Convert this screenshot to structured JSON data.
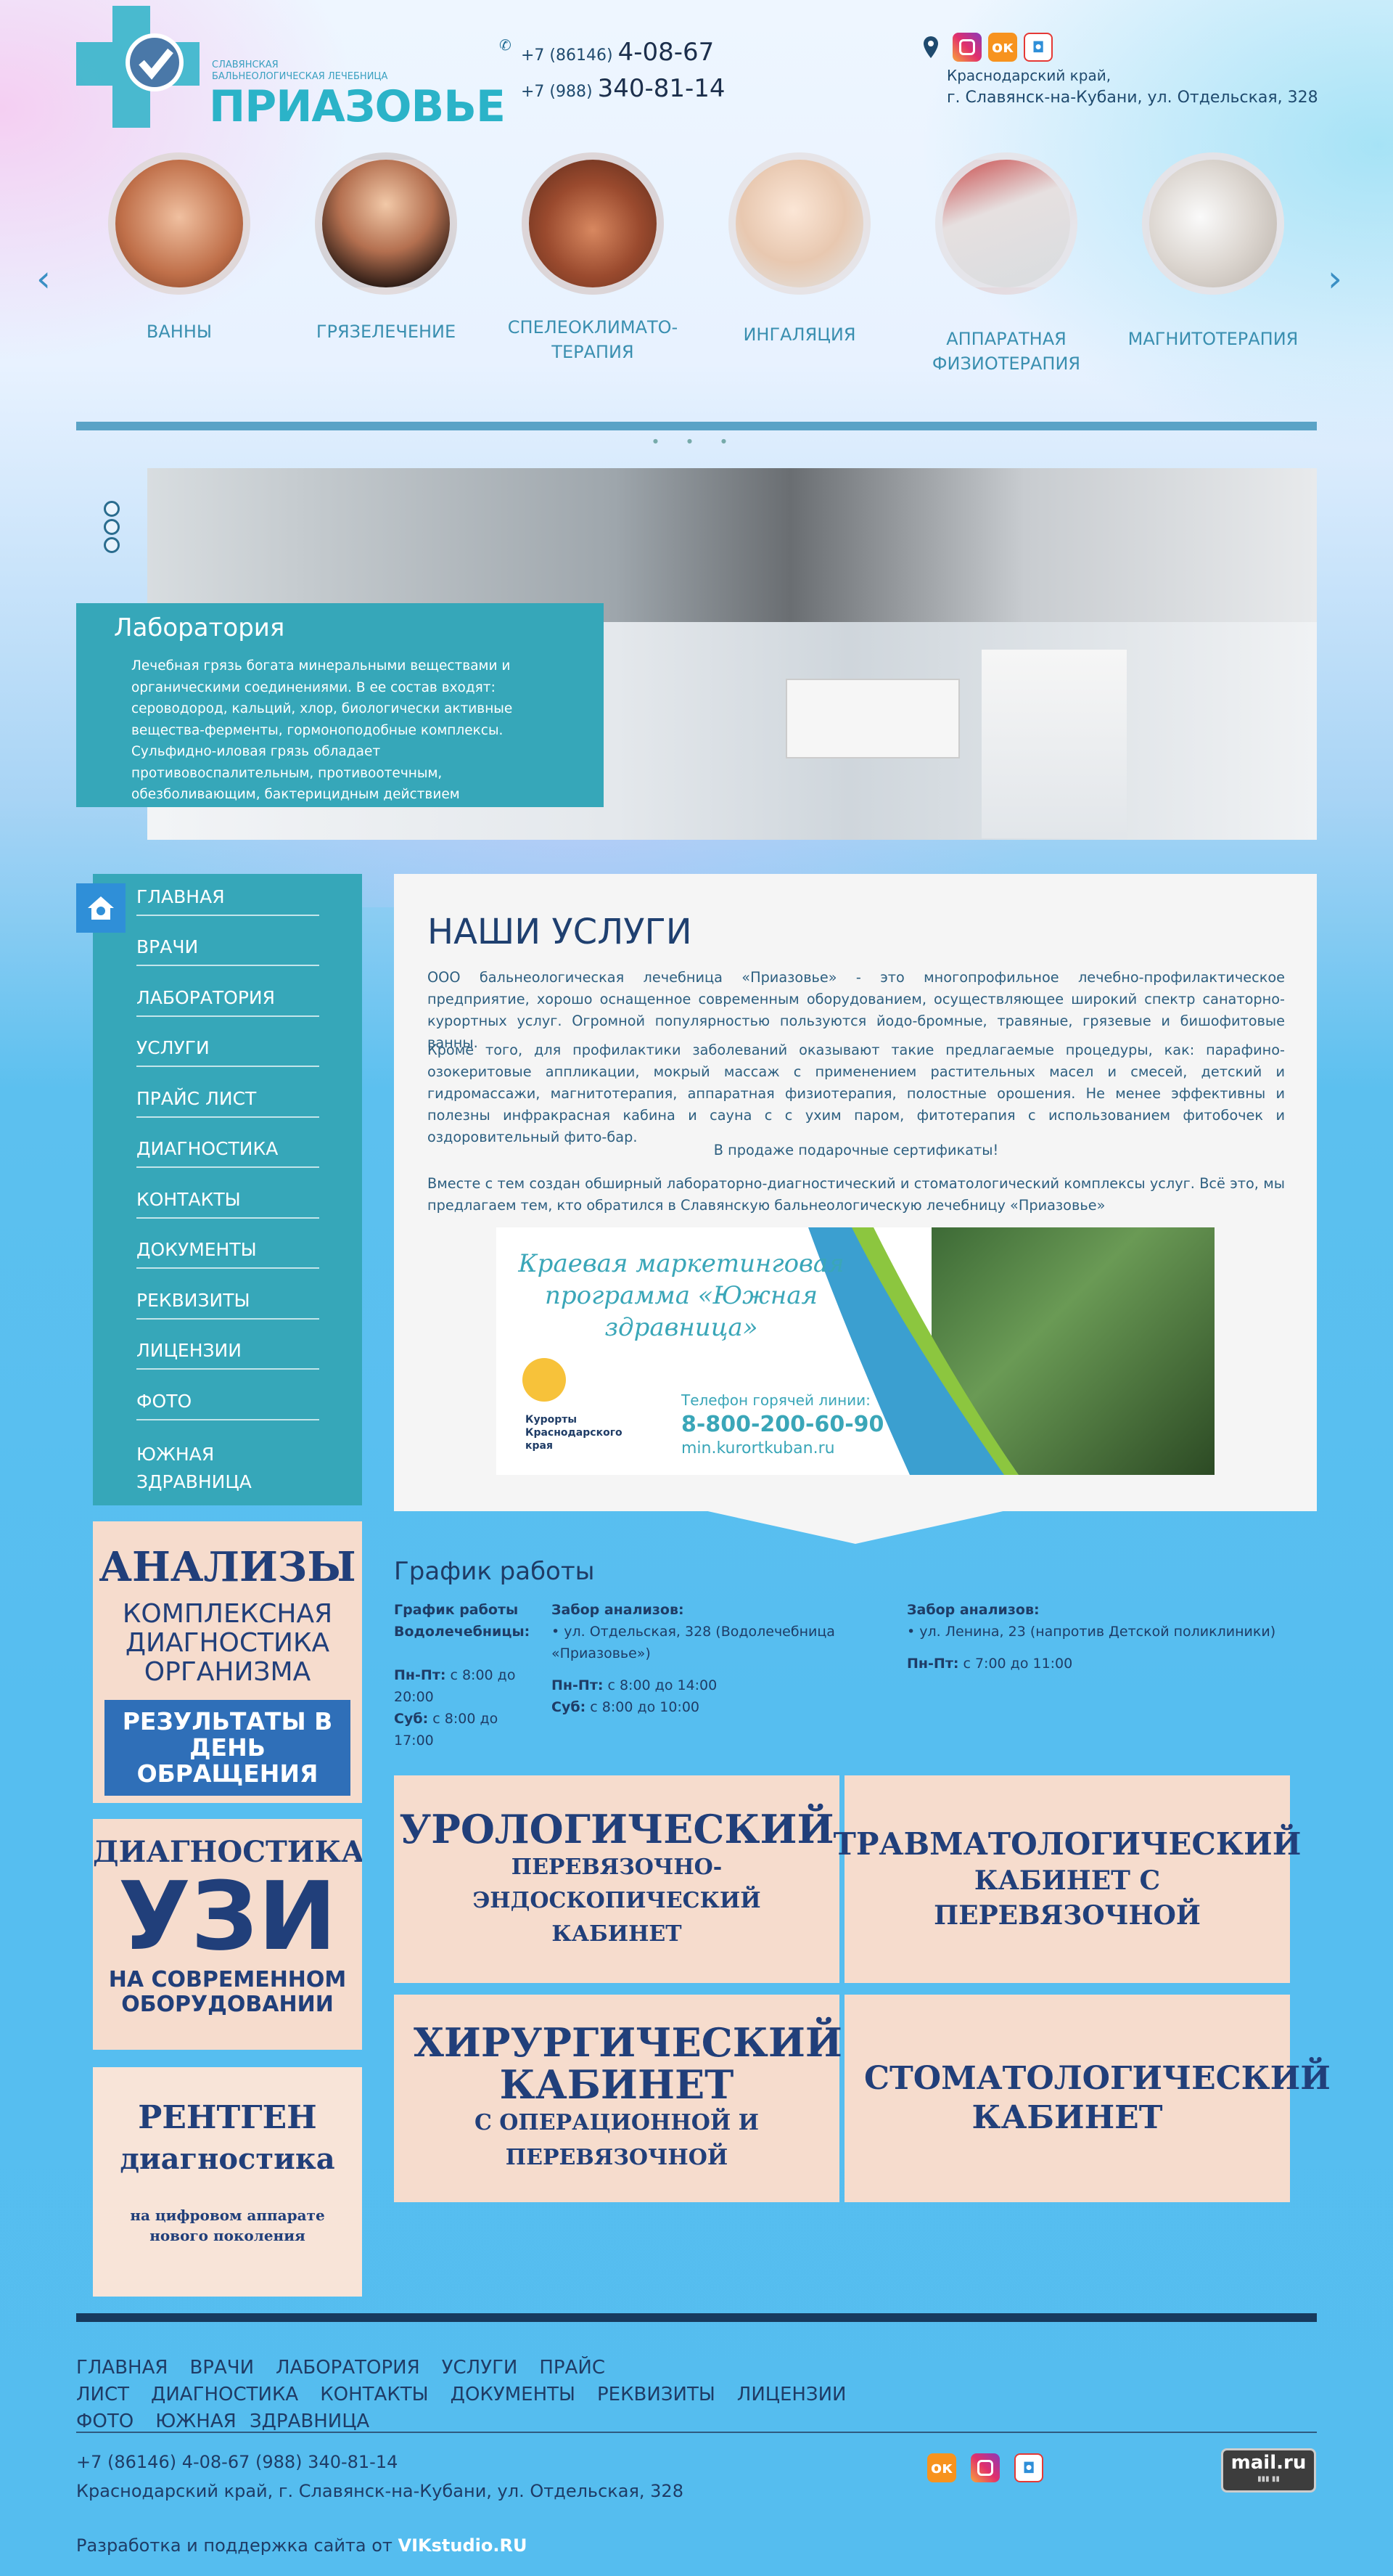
{
  "colors": {
    "accent": "#36a7b9",
    "dark": "#1f3c66",
    "peach": "#f6dccd"
  },
  "header": {
    "logo_sub": "СЛАВЯНСКАЯ\nБАЛЬНЕОЛОГИЧЕСКАЯ ЛЕЧЕБНИЦА",
    "logo_name": "ПРИАЗОВЬЕ",
    "phone1_prefix": "+7 (86146)",
    "phone1_number": "4-08-67",
    "phone2_prefix": "+7 (988)",
    "phone2_number": "340-81-14",
    "address_line1": "Краснодарский край,",
    "address_line2": "г. Славянск-на-Кубани, ул. Отдельская, 328"
  },
  "services": [
    {
      "label": "ВАННЫ"
    },
    {
      "label": "ГРЯЗЕЛЕЧЕНИЕ"
    },
    {
      "label": "СПЕЛЕОКЛИМАТО-ТЕРАПИЯ"
    },
    {
      "label": "ИНГАЛЯЦИЯ"
    },
    {
      "label": "АППАРАТНАЯ ФИЗИОТЕРАПИЯ"
    },
    {
      "label": "МАГНИТОТЕРАПИЯ"
    }
  ],
  "slide": {
    "title": "Лаборатория",
    "text": "Лечебная грязь богата минеральными веществами и органическими соединениями. В ее состав входят: сероводород, кальций, хлор, биологически активные вещества-ферменты, гормоноподобные комплексы. Сульфидно-иловая грязь обладает противовоспалительным, противоотечным, обезболивающим, бактерицидным действием"
  },
  "menu": [
    "ГЛАВНАЯ",
    "ВРАЧИ",
    "ЛАБОРАТОРИЯ",
    "УСЛУГИ",
    "ПРАЙС ЛИСТ",
    "ДИАГНОСТИКА",
    "КОНТАКТЫ",
    "ДОКУМЕНТЫ",
    "РЕКВИЗИТЫ",
    "ЛИЦЕНЗИИ",
    "ФОТО",
    "ЮЖНАЯ ЗДРАВНИЦА"
  ],
  "banners": {
    "b1_title": "АНАЛИЗЫ",
    "b1_sub": "КОМПЛЕКСНАЯ ДИАГНОСТИКА ОРГАНИЗМА",
    "b1_cta": "РЕЗУЛЬТАТЫ В ДЕНЬ ОБРАЩЕНИЯ",
    "b2_top": "ДИАГНОСТИКА",
    "b2_big": "УЗИ",
    "b2_sub": "НА СОВРЕМЕННОМ ОБОРУДОВАНИИ",
    "b3_title": "РЕНТГЕН",
    "b3_sub": "диагностика",
    "b3_note": "на цифровом аппарате нового поколения"
  },
  "main": {
    "title": "НАШИ УСЛУГИ",
    "p1": "ООО бальнеологическая лечебница «Приазовье» - это многопрофильное лечебно-профилактическое предприятие, хорошо оснащенное современным оборудованием, осуществляющее широкий спектр санаторно-курортных услуг. Огромной популярностью пользуются йодо-бромные, травяные, грязевые и бишофитовые ванны.",
    "p2": "Кроме того, для профилактики заболеваний оказывают такие предлагаемые процедуры, как: парафино-озокеритовые аппликации, мокрый массаж с применением растительных масел и смесей, детский и гидромассажи, магнитотерапия, аппаратная физиотерапия, полостные орошения. Не менее эффективны и полезны инфракрасная кабина и сауна с с ухим паром, фитотерапия с использованием фитобочек и оздоровительный фито-бар.",
    "p3": "В продаже подарочные сертификаты!",
    "p4": "Вместе с тем создан обширный лабораторно-диагностический и стоматологический комплексы услуг. Всё это, мы предлагаем тем, кто обратился в Славянскую бальнеологическую лечебницу «Приазовье»"
  },
  "promo": {
    "title": "Краевая маркетинговая программа «Южная здравница»",
    "logo_text": "Курорты Краснодарского края",
    "hotline_label": "Телефон горячей линии:",
    "hotline": "8-800-200-60-90",
    "site": "min.kurortkuban.ru"
  },
  "schedule": {
    "title": "График работы",
    "c1_head": "График работы Водолечебницы:",
    "c1_l1_day": "Пн-Пт:",
    "c1_l1_time": "с 8:00 до 20:00",
    "c1_l2_day": "Суб:",
    "c1_l2_time": "с 8:00 до 17:00",
    "c2_head": "Забор анализов:",
    "c2_place": "• ул. Отдельская, 328 (Водолечебница «Приазовье»)",
    "c2_l1_day": "Пн-Пт:",
    "c2_l1_time": "с 8:00 до 14:00",
    "c2_l2_day": "Суб:",
    "c2_l2_time": "с 8:00 до 10:00",
    "c3_head": "Забор анализов:",
    "c3_place": "• ул. Ленина, 23 (напротив Детской поликлиники)",
    "c3_l1_day": "Пн-Пт:",
    "c3_l1_time": "с 7:00 до 11:00"
  },
  "cabinets": [
    {
      "title": "УРОЛОГИЧЕСКИЙ",
      "sub": "ПЕРЕВЯЗОЧНО-ЭНДОСКОПИЧЕСКИЙ КАБИНЕТ"
    },
    {
      "title": "ТРАВМАТОЛОГИЧЕСКИЙ",
      "sub": "КАБИНЕТ С ПЕРЕВЯЗОЧНОЙ"
    },
    {
      "title": "ХИРУРГИЧЕСКИЙ КАБИНЕТ",
      "sub": "С ОПЕРАЦИОННОЙ И ПЕРЕВЯЗОЧНОЙ"
    },
    {
      "title": "СТОМАТОЛОГИЧЕСКИЙ КАБИНЕТ",
      "sub": ""
    }
  ],
  "footer": {
    "nav": [
      "ГЛАВНАЯ",
      "ВРАЧИ",
      "ЛАБОРАТОРИЯ",
      "УСЛУГИ",
      "ПРАЙС ЛИСТ",
      "ДИАГНОСТИКА",
      "КОНТАКТЫ",
      "ДОКУМЕНТЫ",
      "РЕКВИЗИТЫ",
      "ЛИЦЕНЗИИ",
      "ФОТО",
      "ЮЖНАЯ ЗДРАВНИЦА"
    ],
    "phones": "+7 (86146) 4-08-67 (988) 340-81-14",
    "address": "Краснодарский край, г. Славянск-на-Кубани, ул. Отдельская, 328",
    "credit_prefix": "Разработка и поддержка сайта от",
    "credit_link": "VIKstudio.RU",
    "mail_counter": "mail.ru"
  }
}
